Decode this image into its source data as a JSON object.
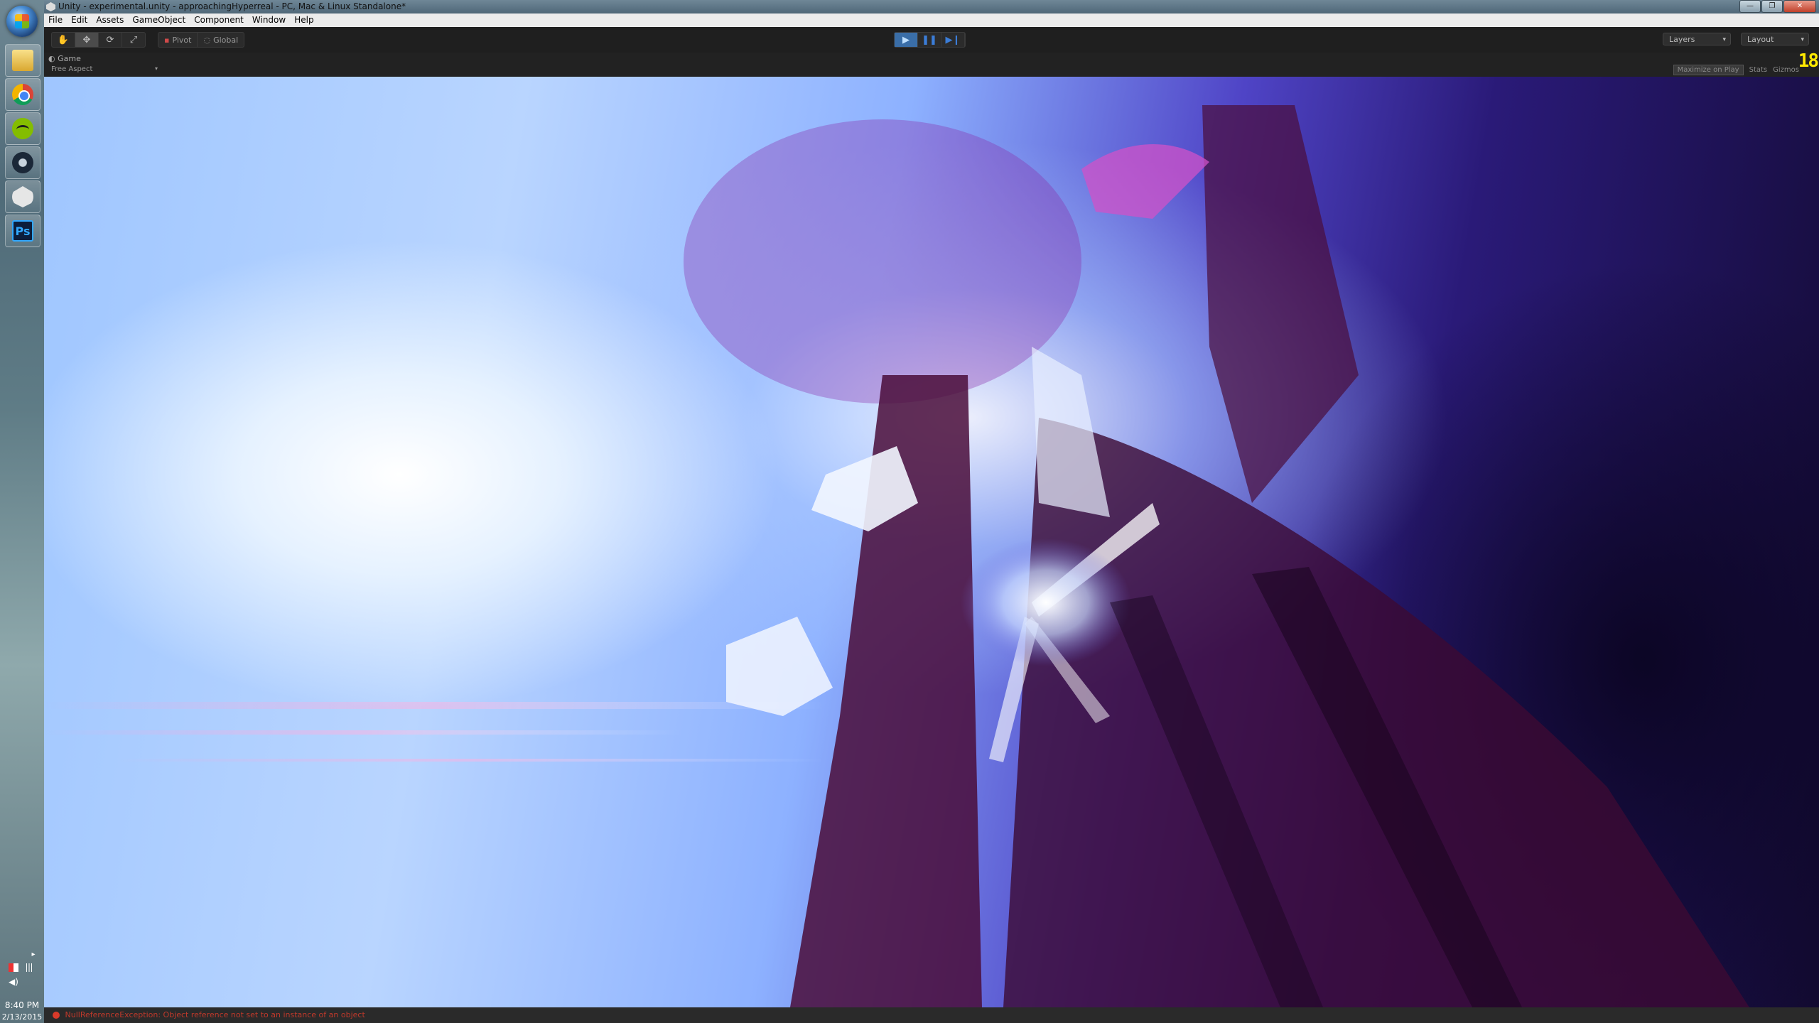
{
  "taskbar": {
    "apps": [
      {
        "name": "Windows Explorer",
        "icon": "folder-icon"
      },
      {
        "name": "Google Chrome",
        "icon": "chrome-icon"
      },
      {
        "name": "Spotify",
        "icon": "spotify-icon"
      },
      {
        "name": "Steam",
        "icon": "steam-icon"
      },
      {
        "name": "Unity",
        "icon": "unity-icon"
      },
      {
        "name": "Photoshop",
        "icon": "photoshop-icon",
        "label": "Ps"
      }
    ],
    "time": "8:40 PM",
    "date": "2/13/2015"
  },
  "window": {
    "title": "Unity - experimental.unity - approachingHyperreal - PC, Mac & Linux Standalone*",
    "menu": [
      "File",
      "Edit",
      "Assets",
      "GameObject",
      "Component",
      "Window",
      "Help"
    ]
  },
  "toolbar": {
    "pivot_label": "Pivot",
    "global_label": "Global",
    "layers_label": "Layers",
    "layout_label": "Layout"
  },
  "game_view": {
    "tab_label": "Game",
    "aspect_label": "Free Aspect",
    "maximize_label": "Maximize on Play",
    "stats_label": "Stats",
    "gizmos_label": "Gizmos",
    "fps_counter": "18"
  },
  "status": {
    "error_message": "NullReferenceException: Object reference not set to an instance of an object"
  },
  "colors": {
    "accent_play": "#3a6ea8",
    "error": "#c0392b",
    "fps": "#ffea00"
  }
}
